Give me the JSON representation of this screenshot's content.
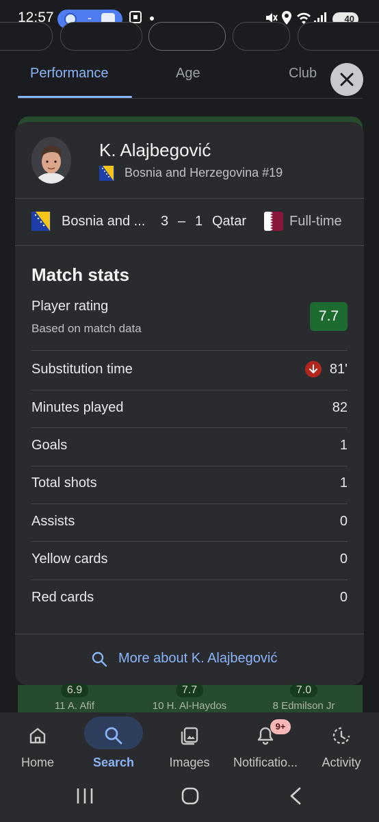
{
  "status_bar": {
    "time": "12:57",
    "battery": "40",
    "signal_label": "6"
  },
  "tabs": [
    {
      "label": "Performance",
      "active": true
    },
    {
      "label": "Age",
      "active": false
    },
    {
      "label": "Club",
      "active": false
    }
  ],
  "player": {
    "name": "K. Alajbegović",
    "team_number": "Bosnia and Herzegovina #19"
  },
  "match": {
    "home_team": "Bosnia and ...",
    "home_score": "3",
    "separator": "–",
    "away_score": "1",
    "away_team": "Qatar",
    "status": "Full-time"
  },
  "stats": {
    "title": "Match stats",
    "rating_label": "Player rating",
    "rating_sub": "Based on match data",
    "rating_value": "7.7",
    "rows": [
      {
        "label": "Substitution time",
        "value": "81'"
      },
      {
        "label": "Minutes played",
        "value": "82"
      },
      {
        "label": "Goals",
        "value": "1"
      },
      {
        "label": "Total shots",
        "value": "1"
      },
      {
        "label": "Assists",
        "value": "0"
      },
      {
        "label": "Yellow cards",
        "value": "0"
      },
      {
        "label": "Red cards",
        "value": "0"
      }
    ]
  },
  "more_link": "More about K. Alajbegović",
  "lineup": [
    {
      "rating": "6.9",
      "name": "11 A. Afif"
    },
    {
      "rating": "7.7",
      "name": "10 H. Al-Haydos"
    },
    {
      "rating": "7.0",
      "name": "8 Edmilson Jr"
    }
  ],
  "bottom_nav": [
    {
      "label": "Home",
      "icon": "home-icon"
    },
    {
      "label": "Search",
      "icon": "search-icon",
      "active": true
    },
    {
      "label": "Images",
      "icon": "images-icon"
    },
    {
      "label": "Notificatio...",
      "icon": "bell-icon",
      "badge": "9+"
    },
    {
      "label": "Activity",
      "icon": "activity-icon"
    }
  ],
  "colors": {
    "accent": "#8ab4f8",
    "rating_green": "#1e6b32",
    "sub_red": "#b3261e"
  }
}
